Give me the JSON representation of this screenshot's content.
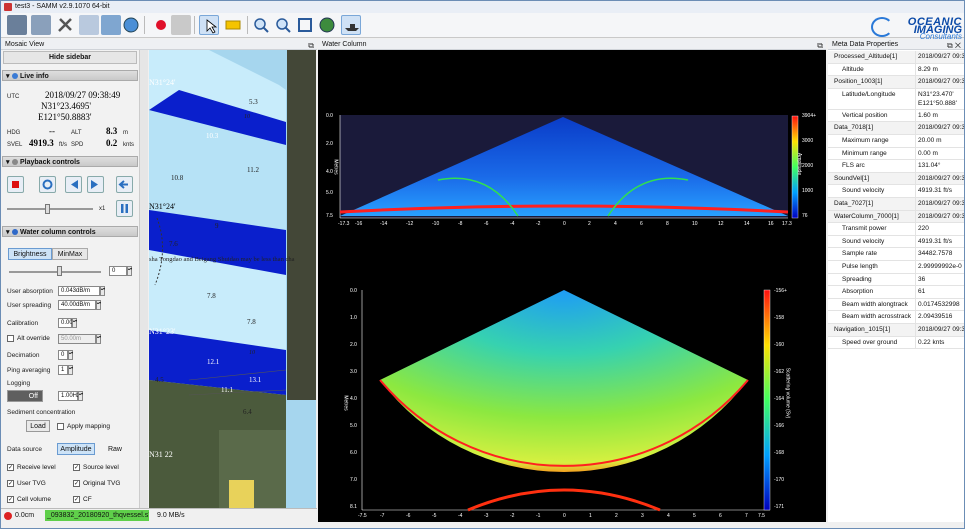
{
  "window": {
    "title": "test3 - SAMM v2.9.1070 64-bit"
  },
  "logo": {
    "line1": "OCEANIC",
    "line2": "IMAGING",
    "line3": "Consultants"
  },
  "mosaic_view": {
    "title": "Mosaic View",
    "hide_sidebar": "Hide sidebar"
  },
  "live_info": {
    "title": "Live info",
    "utc_label": "UTC",
    "utc": "2018/09/27 09:38:49",
    "lat": "N31°23.4695'",
    "lon": "E121°50.8883'",
    "hdg_label": "HDG",
    "hdg_value": "--",
    "alt_label": "ALT",
    "alt_value": "8.3",
    "alt_unit": "m",
    "svel_label": "SVEL",
    "svel_value": "4919.3",
    "svel_unit": "ft/s",
    "spd_label": "SPD",
    "spd_value": "0.2",
    "spd_unit": "knts"
  },
  "playback": {
    "title": "Playback controls",
    "speed": "x1"
  },
  "wcc": {
    "title": "Water column controls",
    "tabs": [
      "Brightness",
      "MinMax"
    ],
    "brightness_value": "0",
    "user_absorption_label": "User absorption",
    "user_absorption": "0.043dB/m",
    "user_spreading_label": "User spreading",
    "user_spreading": "40.00dB/m",
    "calibration_label": "Calibration",
    "calibration": "0.00",
    "alt_override_label": "Alt override",
    "alt_override": "50.00m",
    "decimation_label": "Decimation",
    "decimation": "0",
    "ping_avg_label": "Ping averaging",
    "ping_avg": "1",
    "logging_label": "Logging",
    "logging_state": "Off",
    "logging_rate": "1.00Hz",
    "sediment_label": "Sediment concentration",
    "load_button": "Load",
    "apply_mapping": "Apply mapping",
    "data_source_label": "Data source",
    "amplitude_button": "Amplitude",
    "raw_button": "Raw",
    "checks": [
      {
        "label": "Receive level",
        "checked": true
      },
      {
        "label": "Source level",
        "checked": true
      },
      {
        "label": "User TVG",
        "checked": true
      },
      {
        "label": "Original TVG",
        "checked": true
      },
      {
        "label": "Cell volume",
        "checked": true
      },
      {
        "label": "CF",
        "checked": true
      }
    ]
  },
  "map": {
    "labels": [
      "N31°24'",
      "N31°24'",
      "N31°23'",
      "N31 22"
    ],
    "depths": [
      "5.3",
      "10",
      "10.8",
      "11.2",
      "10.3",
      "9",
      "7.6",
      "7.8",
      "7.8",
      "10",
      "12.1",
      "11.1",
      "4.5",
      "13.1",
      "6.4"
    ],
    "note": "sha Tongdao and Beigang Shuidao may be less than cha"
  },
  "status": {
    "depth": "0.0cm",
    "file": "_093832_20180920_thqvessel.s7k",
    "rate": "9.0 MB/s"
  },
  "water_column": {
    "title": "Water Column",
    "top_ylabel": "Metres",
    "top_colorbar_label": "Amplitude",
    "top_colorbar_ticks": [
      "3904+",
      "3000",
      "2000",
      "1000",
      "76"
    ],
    "top_yticks": [
      "0.0",
      "2.0",
      "4.0",
      "5.0",
      "7.5"
    ],
    "top_xticks": [
      "-17.3",
      "-16",
      "-14",
      "-12",
      "-10",
      "-8",
      "-6",
      "-4",
      "-2",
      "0",
      "2",
      "4",
      "6",
      "8",
      "10",
      "12",
      "14",
      "16",
      "17.3"
    ],
    "bottom_ylabel": "Metres",
    "bottom_colorbar_label": "Scattering volume (Sv)",
    "bottom_colorbar_ticks": [
      "-156+",
      "-158",
      "-160",
      "-162",
      "-164",
      "-166",
      "-168",
      "-170",
      "-171"
    ],
    "bottom_yticks": [
      "0.0",
      "1.0",
      "2.0",
      "3.0",
      "4.0",
      "5.0",
      "6.0",
      "7.0",
      "8.1"
    ],
    "bottom_xticks": [
      "-7.5",
      "-7",
      "-6",
      "-5",
      "-4",
      "-3",
      "-2",
      "-1",
      "0",
      "1",
      "2",
      "3",
      "4",
      "5",
      "6",
      "7",
      "7.5"
    ]
  },
  "meta": {
    "title": "Meta Data Properties",
    "rows": [
      {
        "k": "Processed_Altitude[1]",
        "v": "2018/09/27 09:3",
        "grp": true
      },
      {
        "k": "Altitude",
        "v": "8.29 m",
        "grp": false
      },
      {
        "k": "Position_1003[1]",
        "v": "2018/09/27 09:3",
        "grp": true
      },
      {
        "k": "Latitude/Longitude",
        "v": "N31°23.470' E121°50.888'",
        "grp": false,
        "tall": true
      },
      {
        "k": "Vertical position",
        "v": "1.60 m",
        "grp": false
      },
      {
        "k": "Data_7018[1]",
        "v": "2018/09/27 09:3",
        "grp": true
      },
      {
        "k": "Maximum range",
        "v": "20.00 m",
        "grp": false
      },
      {
        "k": "Minimum range",
        "v": "0.00 m",
        "grp": false
      },
      {
        "k": "FLS arc",
        "v": "131.04°",
        "grp": false
      },
      {
        "k": "SoundVel[1]",
        "v": "2018/09/27 09:3",
        "grp": true
      },
      {
        "k": "Sound velocity",
        "v": "4919.31 ft/s",
        "grp": false
      },
      {
        "k": "Data_7027[1]",
        "v": "2018/09/27 09:3",
        "grp": true
      },
      {
        "k": "WaterColumn_7000[1]",
        "v": "2018/09/27 09:3",
        "grp": true
      },
      {
        "k": "Transmit power",
        "v": "220",
        "grp": false
      },
      {
        "k": "Sound velocity",
        "v": "4919.31 ft/s",
        "grp": false
      },
      {
        "k": "Sample rate",
        "v": "34482.7578",
        "grp": false
      },
      {
        "k": "Pulse length",
        "v": "2.99999992e-0",
        "grp": false
      },
      {
        "k": "Spreading",
        "v": "36",
        "grp": false
      },
      {
        "k": "Absorption",
        "v": "61",
        "grp": false
      },
      {
        "k": "Beam width alongtrack",
        "v": "0.0174532998",
        "grp": false
      },
      {
        "k": "Beam width acrosstrack",
        "v": "2.09439516",
        "grp": false
      },
      {
        "k": "Navigation_1015[1]",
        "v": "2018/09/27 09:3",
        "grp": true
      },
      {
        "k": "Speed over ground",
        "v": "0.22 knts",
        "grp": false
      }
    ]
  }
}
